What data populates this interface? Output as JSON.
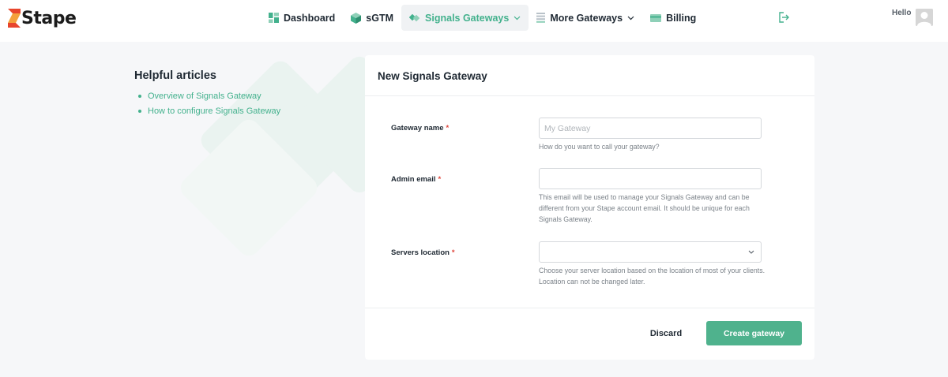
{
  "brand": {
    "name": "Stape",
    "accent": "#43b18d",
    "logo_red": "#e8452c",
    "logo_orange": "#f4a13b"
  },
  "nav": {
    "items": [
      {
        "label": "Dashboard",
        "icon": "dashboard-grid-icon"
      },
      {
        "label": "sGTM",
        "icon": "cube-icon"
      },
      {
        "label": "Signals Gateways",
        "icon": "signals-diamond-icon",
        "active": true,
        "dropdown": true
      },
      {
        "label": "More Gateways",
        "icon": "list-icon",
        "dropdown": true
      },
      {
        "label": "Billing",
        "icon": "credit-card-icon"
      }
    ]
  },
  "user": {
    "greeting": "Hello"
  },
  "articles": {
    "title": "Helpful articles",
    "links": [
      "Overview of Signals Gateway",
      "How to configure Signals Gateway"
    ]
  },
  "form": {
    "title": "New Signals Gateway",
    "gateway_name": {
      "label": "Gateway name",
      "required_mark": "*",
      "placeholder": "My Gateway",
      "value": "",
      "help": "How do you want to call your gateway?"
    },
    "admin_email": {
      "label": "Admin email",
      "required_mark": "*",
      "placeholder": "",
      "value": "",
      "help": "This email will be used to manage your Signals Gateway and can be different from your Stape account email. It should be unique for each Signals Gateway."
    },
    "servers_location": {
      "label": "Servers location",
      "required_mark": "*",
      "value": "",
      "help": "Choose your server location based on the location of most of your clients. Location can not be changed later."
    },
    "discard_label": "Discard",
    "create_label": "Create gateway"
  }
}
